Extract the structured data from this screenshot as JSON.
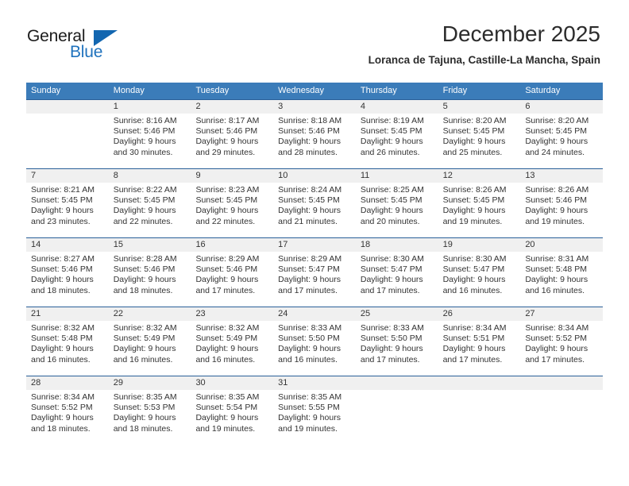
{
  "logo": {
    "text_primary": "General",
    "text_secondary": "Blue",
    "mark": "triangle-flag",
    "primary_color": "#1b1b1b",
    "secondary_color": "#1f72bd",
    "mark_color": "#1266b0"
  },
  "header": {
    "month_title": "December 2025",
    "location": "Loranca de Tajuna, Castille-La Mancha, Spain"
  },
  "theme": {
    "header_band": "#3b7cb9",
    "row_divider": "#2a6099",
    "daynum_band": "#f0f0f0",
    "text": "#333333"
  },
  "weekdays": [
    "Sunday",
    "Monday",
    "Tuesday",
    "Wednesday",
    "Thursday",
    "Friday",
    "Saturday"
  ],
  "weeks": [
    [
      {
        "day": "",
        "lines": []
      },
      {
        "day": "1",
        "lines": [
          "Sunrise: 8:16 AM",
          "Sunset: 5:46 PM",
          "Daylight: 9 hours",
          "and 30 minutes."
        ]
      },
      {
        "day": "2",
        "lines": [
          "Sunrise: 8:17 AM",
          "Sunset: 5:46 PM",
          "Daylight: 9 hours",
          "and 29 minutes."
        ]
      },
      {
        "day": "3",
        "lines": [
          "Sunrise: 8:18 AM",
          "Sunset: 5:46 PM",
          "Daylight: 9 hours",
          "and 28 minutes."
        ]
      },
      {
        "day": "4",
        "lines": [
          "Sunrise: 8:19 AM",
          "Sunset: 5:45 PM",
          "Daylight: 9 hours",
          "and 26 minutes."
        ]
      },
      {
        "day": "5",
        "lines": [
          "Sunrise: 8:20 AM",
          "Sunset: 5:45 PM",
          "Daylight: 9 hours",
          "and 25 minutes."
        ]
      },
      {
        "day": "6",
        "lines": [
          "Sunrise: 8:20 AM",
          "Sunset: 5:45 PM",
          "Daylight: 9 hours",
          "and 24 minutes."
        ]
      }
    ],
    [
      {
        "day": "7",
        "lines": [
          "Sunrise: 8:21 AM",
          "Sunset: 5:45 PM",
          "Daylight: 9 hours",
          "and 23 minutes."
        ]
      },
      {
        "day": "8",
        "lines": [
          "Sunrise: 8:22 AM",
          "Sunset: 5:45 PM",
          "Daylight: 9 hours",
          "and 22 minutes."
        ]
      },
      {
        "day": "9",
        "lines": [
          "Sunrise: 8:23 AM",
          "Sunset: 5:45 PM",
          "Daylight: 9 hours",
          "and 22 minutes."
        ]
      },
      {
        "day": "10",
        "lines": [
          "Sunrise: 8:24 AM",
          "Sunset: 5:45 PM",
          "Daylight: 9 hours",
          "and 21 minutes."
        ]
      },
      {
        "day": "11",
        "lines": [
          "Sunrise: 8:25 AM",
          "Sunset: 5:45 PM",
          "Daylight: 9 hours",
          "and 20 minutes."
        ]
      },
      {
        "day": "12",
        "lines": [
          "Sunrise: 8:26 AM",
          "Sunset: 5:45 PM",
          "Daylight: 9 hours",
          "and 19 minutes."
        ]
      },
      {
        "day": "13",
        "lines": [
          "Sunrise: 8:26 AM",
          "Sunset: 5:46 PM",
          "Daylight: 9 hours",
          "and 19 minutes."
        ]
      }
    ],
    [
      {
        "day": "14",
        "lines": [
          "Sunrise: 8:27 AM",
          "Sunset: 5:46 PM",
          "Daylight: 9 hours",
          "and 18 minutes."
        ]
      },
      {
        "day": "15",
        "lines": [
          "Sunrise: 8:28 AM",
          "Sunset: 5:46 PM",
          "Daylight: 9 hours",
          "and 18 minutes."
        ]
      },
      {
        "day": "16",
        "lines": [
          "Sunrise: 8:29 AM",
          "Sunset: 5:46 PM",
          "Daylight: 9 hours",
          "and 17 minutes."
        ]
      },
      {
        "day": "17",
        "lines": [
          "Sunrise: 8:29 AM",
          "Sunset: 5:47 PM",
          "Daylight: 9 hours",
          "and 17 minutes."
        ]
      },
      {
        "day": "18",
        "lines": [
          "Sunrise: 8:30 AM",
          "Sunset: 5:47 PM",
          "Daylight: 9 hours",
          "and 17 minutes."
        ]
      },
      {
        "day": "19",
        "lines": [
          "Sunrise: 8:30 AM",
          "Sunset: 5:47 PM",
          "Daylight: 9 hours",
          "and 16 minutes."
        ]
      },
      {
        "day": "20",
        "lines": [
          "Sunrise: 8:31 AM",
          "Sunset: 5:48 PM",
          "Daylight: 9 hours",
          "and 16 minutes."
        ]
      }
    ],
    [
      {
        "day": "21",
        "lines": [
          "Sunrise: 8:32 AM",
          "Sunset: 5:48 PM",
          "Daylight: 9 hours",
          "and 16 minutes."
        ]
      },
      {
        "day": "22",
        "lines": [
          "Sunrise: 8:32 AM",
          "Sunset: 5:49 PM",
          "Daylight: 9 hours",
          "and 16 minutes."
        ]
      },
      {
        "day": "23",
        "lines": [
          "Sunrise: 8:32 AM",
          "Sunset: 5:49 PM",
          "Daylight: 9 hours",
          "and 16 minutes."
        ]
      },
      {
        "day": "24",
        "lines": [
          "Sunrise: 8:33 AM",
          "Sunset: 5:50 PM",
          "Daylight: 9 hours",
          "and 16 minutes."
        ]
      },
      {
        "day": "25",
        "lines": [
          "Sunrise: 8:33 AM",
          "Sunset: 5:50 PM",
          "Daylight: 9 hours",
          "and 17 minutes."
        ]
      },
      {
        "day": "26",
        "lines": [
          "Sunrise: 8:34 AM",
          "Sunset: 5:51 PM",
          "Daylight: 9 hours",
          "and 17 minutes."
        ]
      },
      {
        "day": "27",
        "lines": [
          "Sunrise: 8:34 AM",
          "Sunset: 5:52 PM",
          "Daylight: 9 hours",
          "and 17 minutes."
        ]
      }
    ],
    [
      {
        "day": "28",
        "lines": [
          "Sunrise: 8:34 AM",
          "Sunset: 5:52 PM",
          "Daylight: 9 hours",
          "and 18 minutes."
        ]
      },
      {
        "day": "29",
        "lines": [
          "Sunrise: 8:35 AM",
          "Sunset: 5:53 PM",
          "Daylight: 9 hours",
          "and 18 minutes."
        ]
      },
      {
        "day": "30",
        "lines": [
          "Sunrise: 8:35 AM",
          "Sunset: 5:54 PM",
          "Daylight: 9 hours",
          "and 19 minutes."
        ]
      },
      {
        "day": "31",
        "lines": [
          "Sunrise: 8:35 AM",
          "Sunset: 5:55 PM",
          "Daylight: 9 hours",
          "and 19 minutes."
        ]
      },
      {
        "day": "",
        "lines": []
      },
      {
        "day": "",
        "lines": []
      },
      {
        "day": "",
        "lines": []
      }
    ]
  ]
}
